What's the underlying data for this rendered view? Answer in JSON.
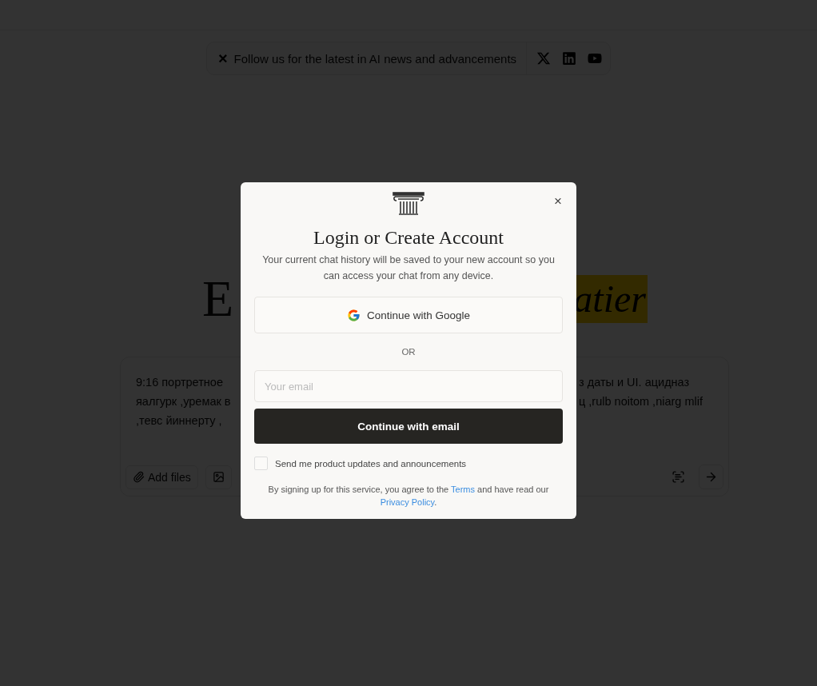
{
  "announcement": {
    "close": "×",
    "text": "Follow us for the latest in AI news and advancements"
  },
  "hero": {
    "heading_left": "E",
    "heading_right": "atier"
  },
  "prompt": {
    "lines": [
      {
        "left": "9:16 портретное",
        "right": "з даты и UI. ацидназ"
      },
      {
        "left": "яалгурк ,уремак в",
        "right": "ц ,rulb noitom ,niarg mlif"
      },
      {
        "left": ",тевс йиннерту ,"
      }
    ],
    "add_files": "Add files"
  },
  "modal": {
    "close": "×",
    "title": "Login or Create Account",
    "subtitle": "Your current chat history will be saved to your new account so you can access your chat from any device.",
    "google_button": "Continue with Google",
    "divider": "OR",
    "email_placeholder": "Your email",
    "email_button": "Continue with email",
    "updates": {
      "label": "Send me product updates and announcements",
      "checked": false
    },
    "legal": {
      "before": "By signing up for this service, you agree to the ",
      "terms": "Terms",
      "middle": " and have read our ",
      "privacy": "Privacy Policy",
      "after": "."
    }
  }
}
